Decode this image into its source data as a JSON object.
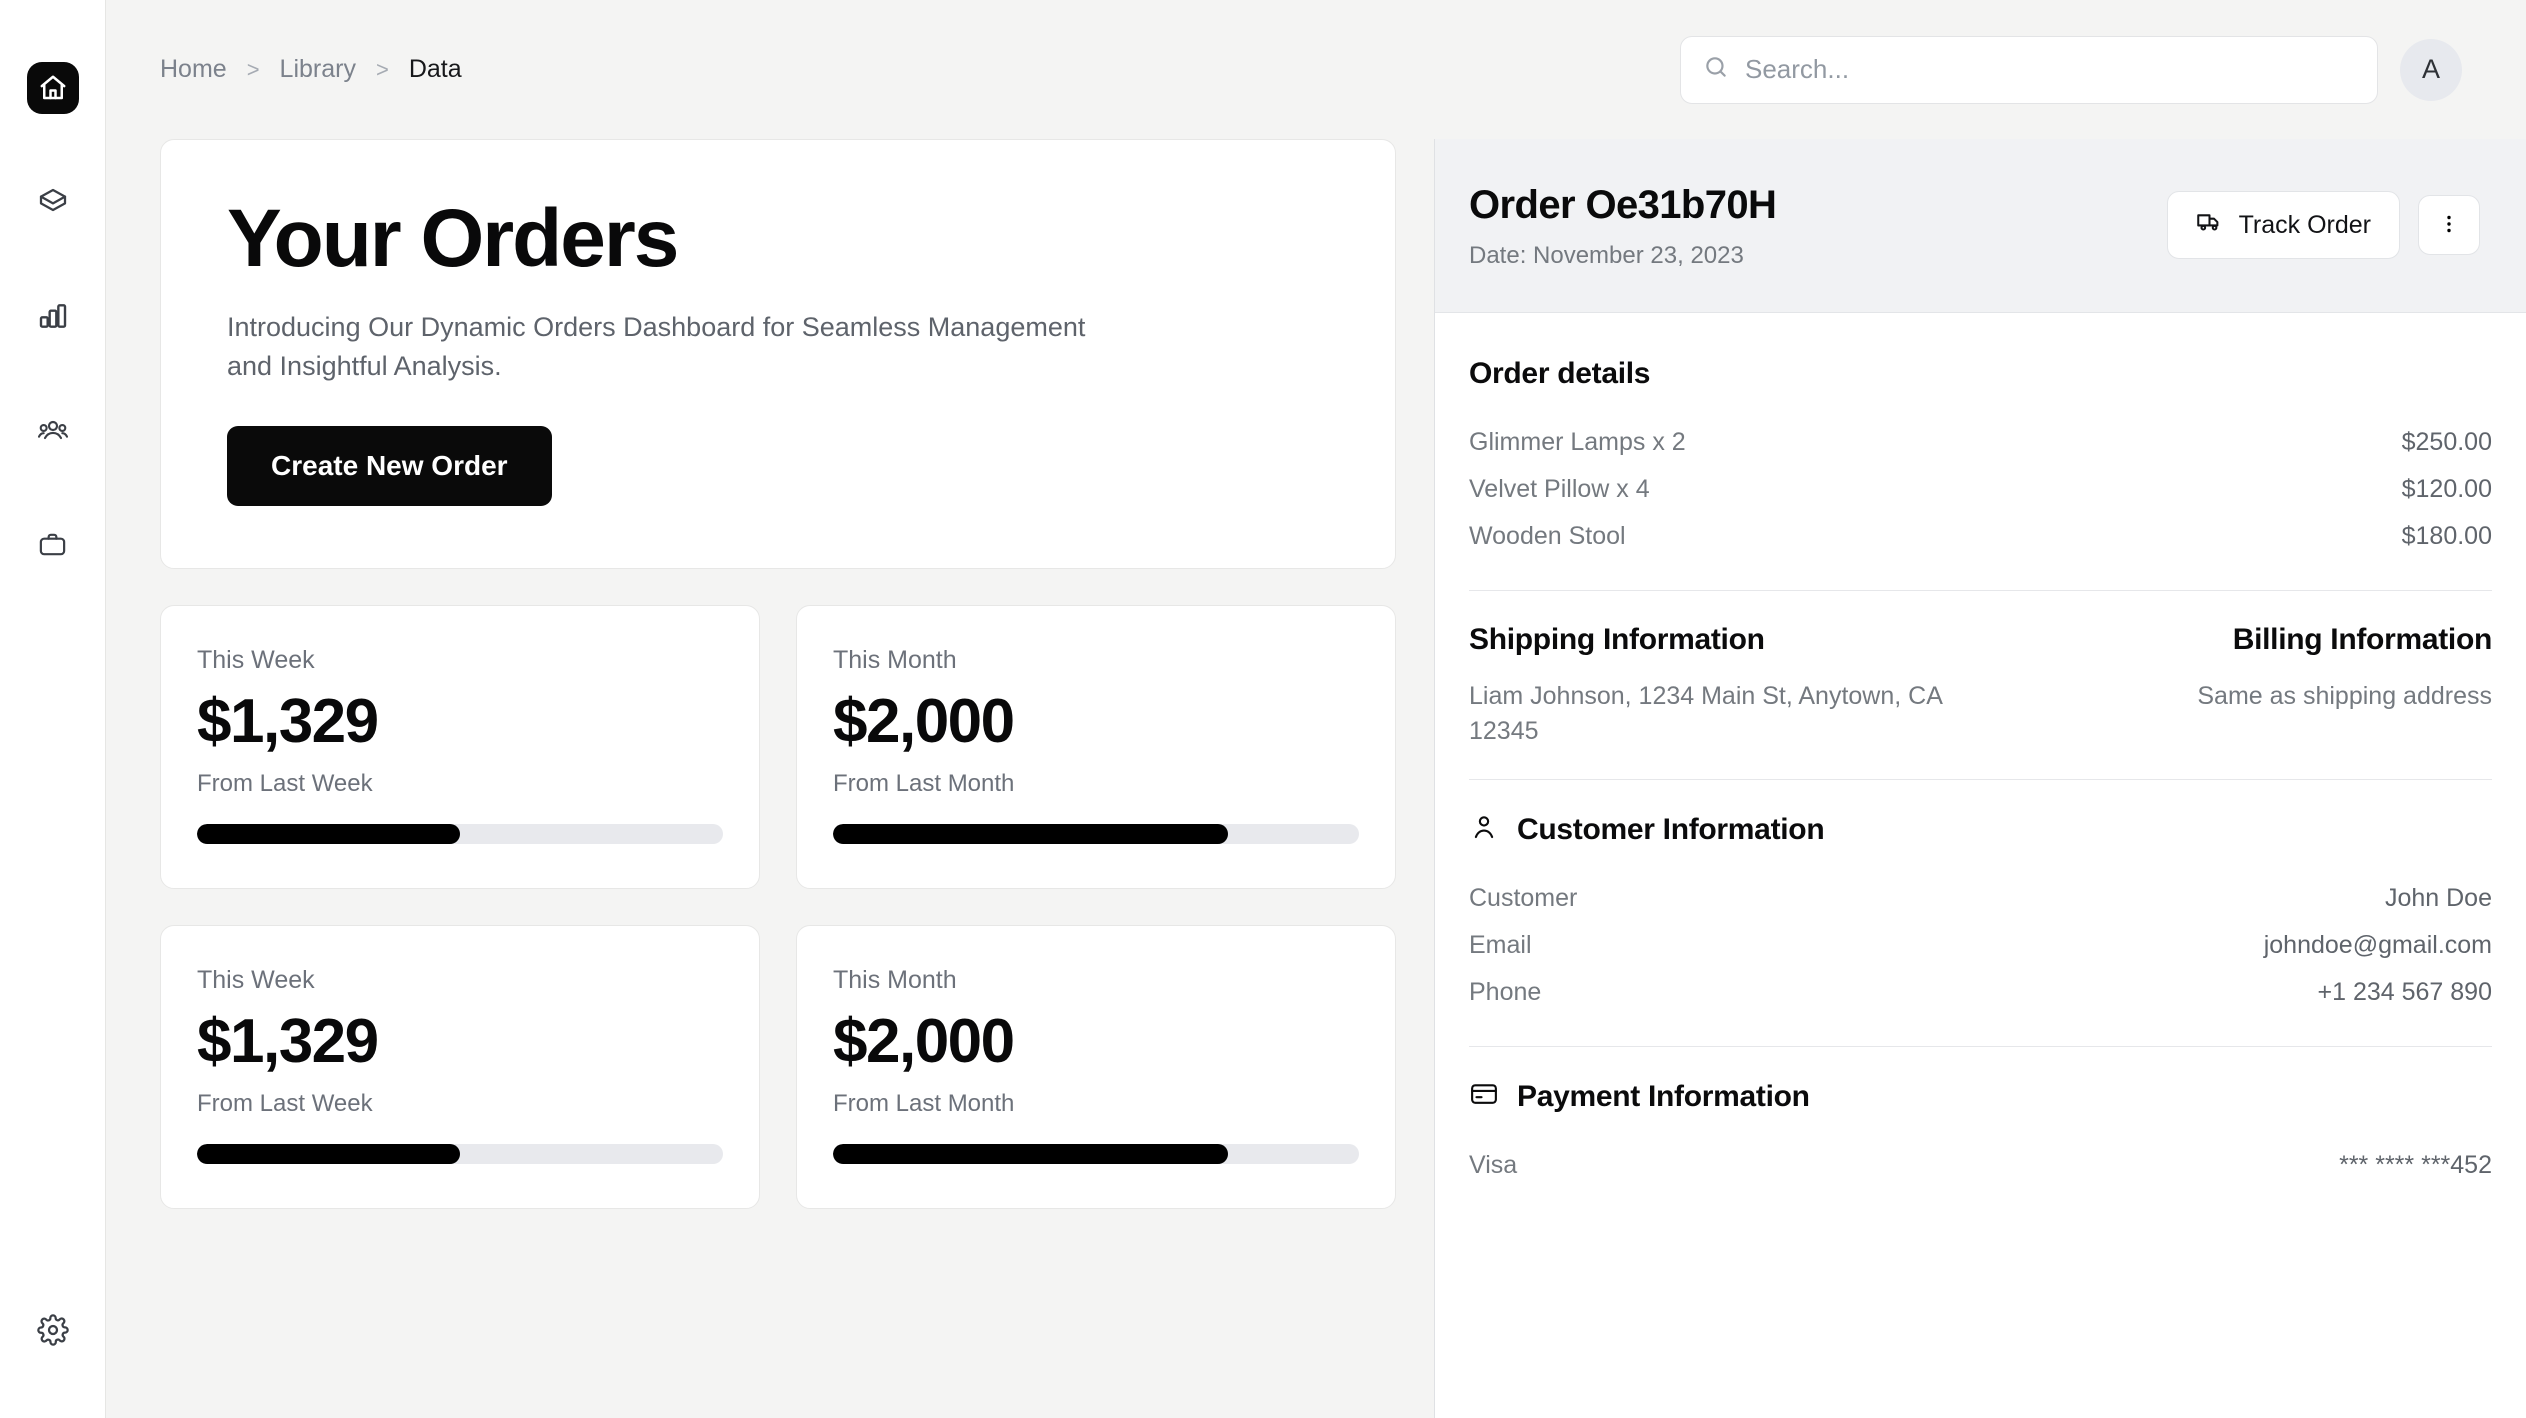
{
  "sidebar": {
    "items": [
      {
        "name": "home",
        "icon": "home-icon",
        "active": true
      },
      {
        "name": "package",
        "icon": "package-icon",
        "active": false
      },
      {
        "name": "analytics",
        "icon": "bar-chart-icon",
        "active": false
      },
      {
        "name": "customers",
        "icon": "users-icon",
        "active": false
      },
      {
        "name": "orders",
        "icon": "briefcase-icon",
        "active": false
      }
    ],
    "settings": {
      "name": "settings",
      "icon": "gear-icon"
    }
  },
  "topbar": {
    "breadcrumb": [
      {
        "label": "Home",
        "current": false
      },
      {
        "label": "Library",
        "current": false
      },
      {
        "label": "Data",
        "current": true
      }
    ],
    "separator": ">",
    "search": {
      "placeholder": "Search...",
      "value": "",
      "icon": "search-icon"
    },
    "avatar": {
      "initial": "A"
    }
  },
  "hero": {
    "title": "Your Orders",
    "subtitle": "Introducing Our Dynamic Orders Dashboard for Seamless Management and Insightful Analysis.",
    "cta_label": "Create New Order"
  },
  "stats": [
    {
      "label": "This Week",
      "value": "$1,329",
      "caption": "From Last Week",
      "progress": 50
    },
    {
      "label": "This Month",
      "value": "$2,000",
      "caption": "From Last Month",
      "progress": 75
    },
    {
      "label": "This Week",
      "value": "$1,329",
      "caption": "From Last Week",
      "progress": 50
    },
    {
      "label": "This Month",
      "value": "$2,000",
      "caption": "From Last Month",
      "progress": 75
    }
  ],
  "order": {
    "id": "Order Oe31b70H",
    "date": "Date: November 23, 2023",
    "track_label": "Track Order",
    "track_icon": "truck-icon",
    "more_icon": "more-vertical-icon",
    "details": {
      "title": "Order details",
      "items": [
        {
          "name": "Glimmer Lamps x 2",
          "price": "$250.00"
        },
        {
          "name": "Velvet Pillow x 4",
          "price": "$120.00"
        },
        {
          "name": "Wooden Stool",
          "price": "$180.00"
        }
      ]
    },
    "shipping": {
      "title": "Shipping Information",
      "text": "Liam Johnson, 1234 Main St, Anytown, CA 12345"
    },
    "billing": {
      "title": "Billing Information",
      "text": "Same as shipping address"
    },
    "customer": {
      "title": "Customer Information",
      "icon": "user-icon",
      "rows": [
        {
          "key": "Customer",
          "value": "John Doe"
        },
        {
          "key": "Email",
          "value": "johndoe@gmail.com"
        },
        {
          "key": "Phone",
          "value": "+1 234 567 890"
        }
      ]
    },
    "payment": {
      "title": "Payment Information",
      "icon": "credit-card-icon",
      "rows": [
        {
          "key": "Visa",
          "value": "*** **** ***452"
        }
      ]
    }
  },
  "colors": {
    "accent": "#0a0a0a",
    "page_bg": "#f4f4f3",
    "panel_header_bg": "#f1f2f4",
    "muted_text": "#74797f",
    "progress_track": "#e8e9ed"
  }
}
